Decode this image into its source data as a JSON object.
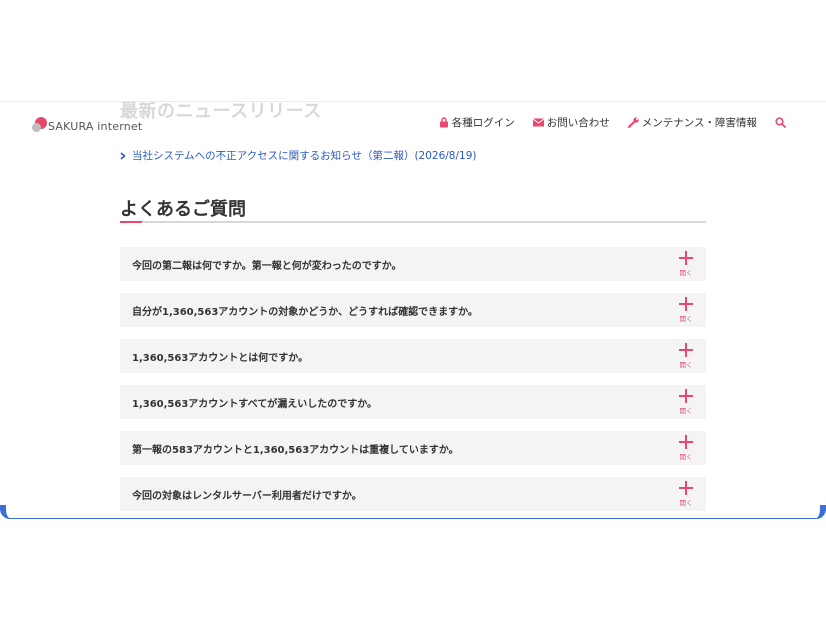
{
  "ghost_heading": "最新のニュースリリース",
  "header": {
    "logo_text": "SAKURA internet",
    "nav": {
      "login": "各種ログイン",
      "contact": "お問い合わせ",
      "maintenance": "メンテナンス・障害情報"
    }
  },
  "news": {
    "link_text": "当社システムへの不正アクセスに関するお知らせ（第二報）(2026/8/19)"
  },
  "faq": {
    "title": "よくあるご質問",
    "toggle_label": "開く",
    "items": [
      {
        "q": "今回の第二報は何ですか。第一報と何が変わったのですか。"
      },
      {
        "q": "自分が1,360,563アカウントの対象かどうか、どうすれば確認できますか。"
      },
      {
        "q": "1,360,563アカウントとは何ですか。"
      },
      {
        "q": "1,360,563アカウントすべてが漏えいしたのですか。"
      },
      {
        "q": "第一報の583アカウントと1,360,563アカウントは重複していますか。"
      },
      {
        "q": "今回の対象はレンタルサーバー利用者だけですか。"
      }
    ]
  },
  "colors": {
    "accent": "#e8486b",
    "link": "#2b59c3",
    "frame": "#3b6fd6"
  }
}
